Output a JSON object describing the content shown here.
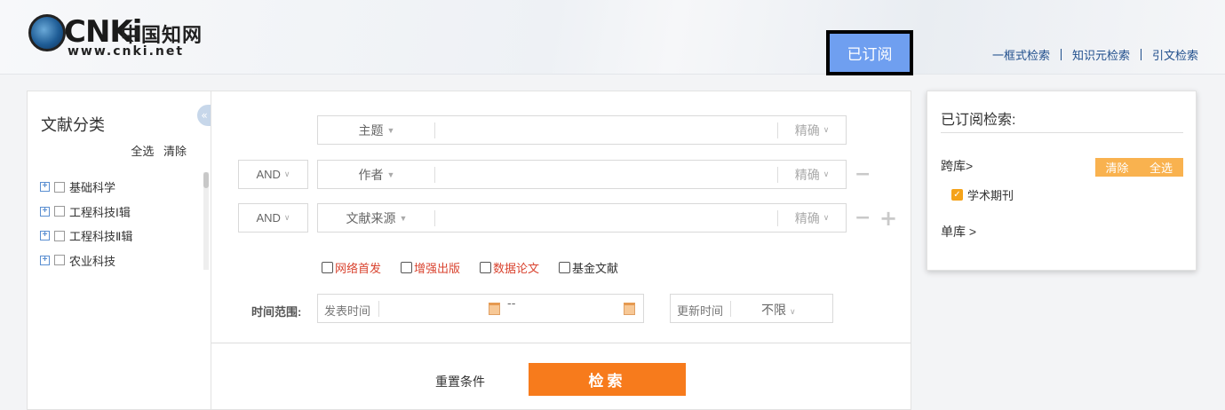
{
  "header": {
    "logo_brand": "CNKi",
    "logo_cn": "中国知网",
    "logo_url": "www.cnki.net",
    "subscribed_label": "已订阅",
    "links": [
      "一框式检索",
      "知识元检索",
      "引文检索"
    ]
  },
  "left": {
    "title": "文献分类",
    "select_all": "全选",
    "clear": "清除",
    "categories": [
      "基础科学",
      "工程科技Ⅰ辑",
      "工程科技Ⅱ辑",
      "农业科技"
    ]
  },
  "search": {
    "rows": [
      {
        "logic": "",
        "field": "主题",
        "match": "精确"
      },
      {
        "logic": "AND",
        "field": "作者",
        "match": "精确"
      },
      {
        "logic": "AND",
        "field": "文献来源",
        "match": "精确"
      }
    ],
    "options": [
      "网络首发",
      "增强出版",
      "数据论文",
      "基金文献"
    ],
    "time_label": "时间范围:",
    "publish_placeholder": "发表时间",
    "date_sep": "--",
    "update_placeholder": "更新时间",
    "update_value": "不限",
    "reset_label": "重置条件",
    "search_label": "检索"
  },
  "right": {
    "title": "已订阅检索:",
    "cross_label": "跨库>",
    "clear_label": "清除",
    "select_all_label": "全选",
    "journal_label": "学术期刊",
    "single_label": "单库 >"
  },
  "colors": {
    "search_button": "#f77b1c",
    "subscribed_button": "#6f9ff0",
    "accent_orange": "#f9b24f",
    "link_blue": "#1f4e8c",
    "option_red": "#d9432f"
  }
}
